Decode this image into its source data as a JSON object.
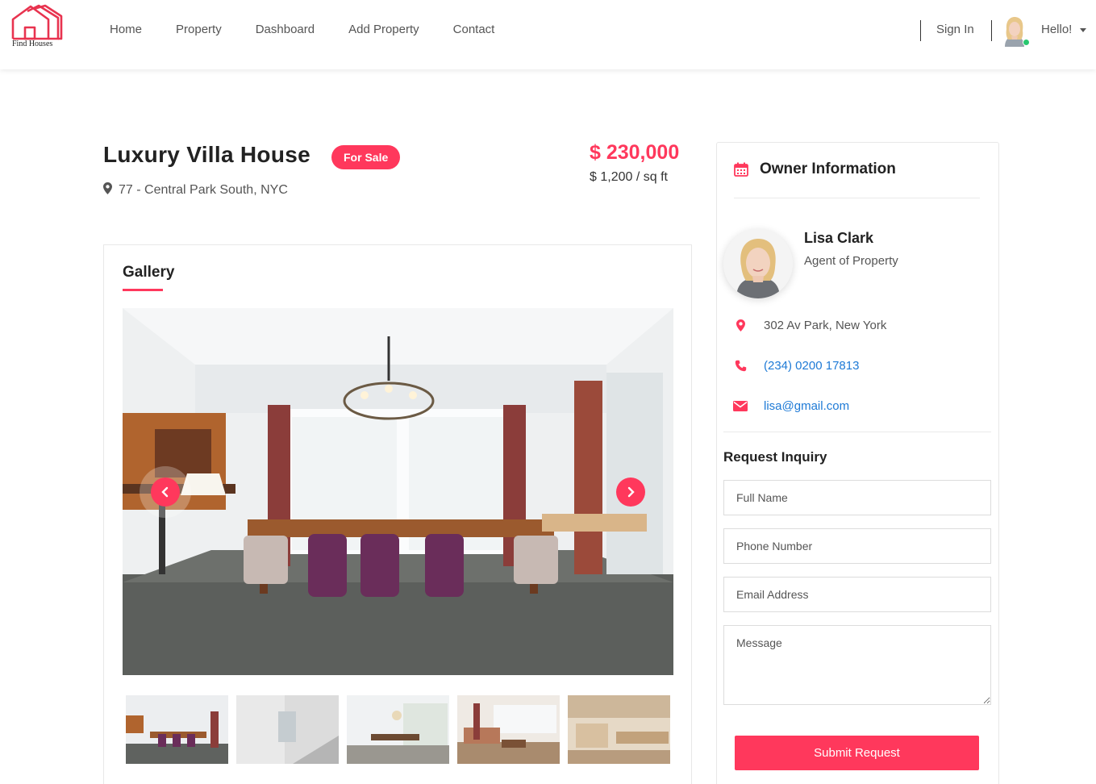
{
  "header": {
    "logo_text": "Find Houses",
    "nav": [
      "Home",
      "Property",
      "Dashboard",
      "Add Property",
      "Contact"
    ],
    "sign_in": "Sign In",
    "greeting": "Hello!"
  },
  "property": {
    "title": "Luxury Villa House",
    "badge": "For Sale",
    "address": "77 - Central Park South, NYC",
    "price": "$ 230,000",
    "price_per_sqft": "$ 1,200 / sq ft"
  },
  "gallery": {
    "heading": "Gallery",
    "thumbnail_count": 5
  },
  "owner": {
    "heading": "Owner Information",
    "name": "Lisa Clark",
    "role": "Agent of Property",
    "address": "302 Av Park, New York",
    "phone": "(234) 0200 17813",
    "email": "lisa@gmail.com"
  },
  "inquiry": {
    "title": "Request Inquiry",
    "full_name_placeholder": "Full Name",
    "phone_placeholder": "Phone Number",
    "email_placeholder": "Email Address",
    "message_placeholder": "Message",
    "submit_label": "Submit Request"
  },
  "colors": {
    "accent": "#ff385c",
    "link": "#1e7ad6",
    "text": "#222222",
    "muted": "#555555"
  },
  "icons": {
    "logo": "house-outline-icon",
    "location": "map-pin-icon",
    "calendar": "calendar-icon",
    "phone": "phone-icon",
    "email": "envelope-icon",
    "prev": "chevron-left-icon",
    "next": "chevron-right-icon",
    "user_menu": "caret-down-icon"
  }
}
